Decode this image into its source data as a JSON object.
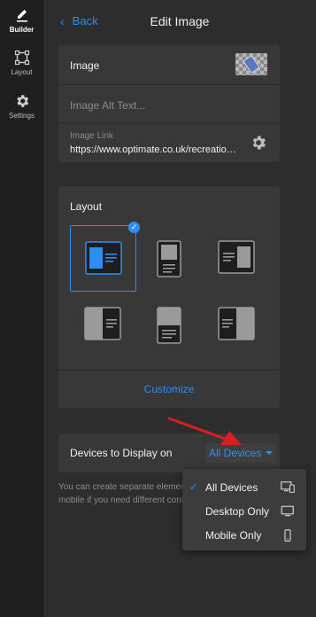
{
  "rail": {
    "items": [
      {
        "label": "Builder",
        "icon": "pencil-icon",
        "active": true
      },
      {
        "label": "Layout",
        "icon": "layout-frame-icon",
        "active": false
      },
      {
        "label": "Settings",
        "icon": "gear-icon",
        "active": false
      }
    ]
  },
  "header": {
    "back_label": "Back",
    "title": "Edit Image"
  },
  "image_section": {
    "image_label": "Image",
    "alt_text_placeholder": "Image Alt Text...",
    "alt_text_value": "",
    "link_label": "Image Link",
    "link_value": "https://www.optimate.co.uk/recreational-vehicles"
  },
  "layout_section": {
    "label": "Layout",
    "options": [
      {
        "name": "image-left-text-right",
        "selected": true
      },
      {
        "name": "image-top-text-bottom",
        "selected": false
      },
      {
        "name": "text-left-image-right",
        "selected": false
      },
      {
        "name": "image-left-half-text-right",
        "selected": false
      },
      {
        "name": "image-top-half-text-bottom",
        "selected": false
      },
      {
        "name": "text-left-image-right-half",
        "selected": false
      }
    ],
    "customize_label": "Customize"
  },
  "devices": {
    "label": "Devices to Display on",
    "selected": "All Devices",
    "note": "You can create separate elements for desktop and mobile if you need different content.",
    "options": [
      {
        "label": "All Devices",
        "icon": "desktop-mobile-icon",
        "selected": true
      },
      {
        "label": "Desktop Only",
        "icon": "desktop-icon",
        "selected": false
      },
      {
        "label": "Mobile Only",
        "icon": "mobile-icon",
        "selected": false
      }
    ]
  },
  "colors": {
    "accent": "#2d8ff5",
    "panel": "#2d2d2d",
    "card": "#383838",
    "rail": "#1f1f1f",
    "annotation_arrow": "#d9201f"
  }
}
